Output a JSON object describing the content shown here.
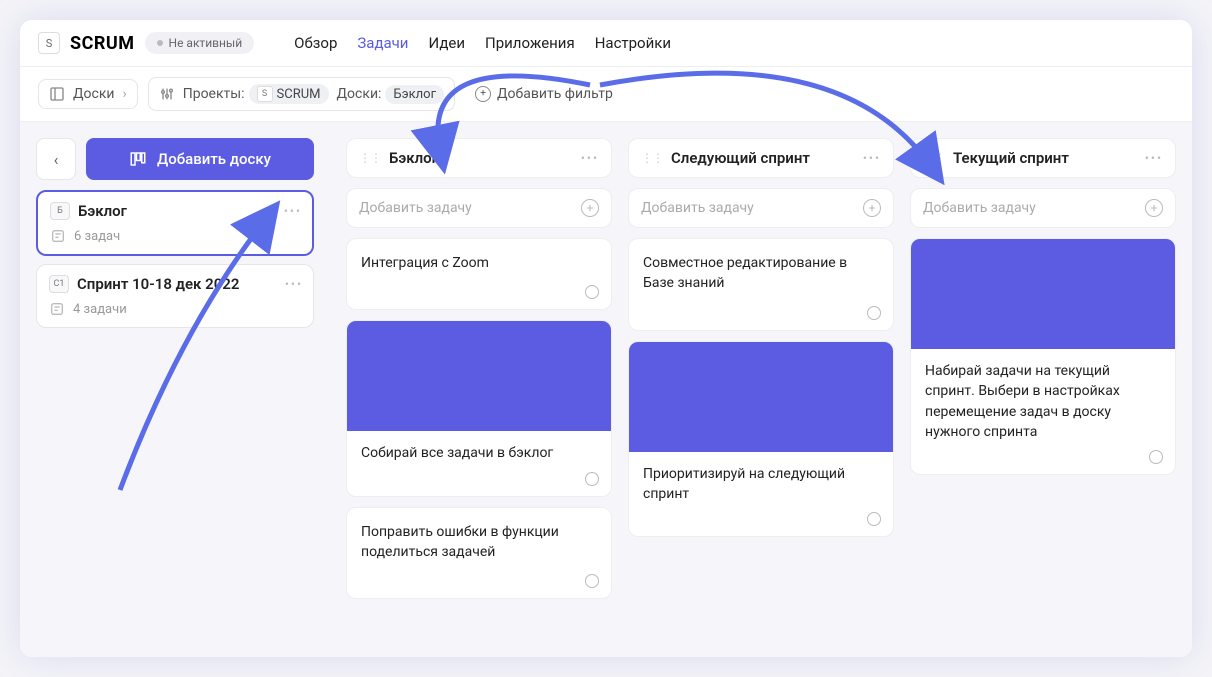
{
  "header": {
    "project_badge": "S",
    "project_name": "SCRUM",
    "status_label": "Не активный",
    "nav": {
      "overview": "Обзор",
      "tasks": "Задачи",
      "ideas": "Идеи",
      "apps": "Приложения",
      "settings": "Настройки"
    }
  },
  "toolbar": {
    "breadcrumb_label": "Доски",
    "filter_projects_label": "Проекты:",
    "filter_projects_badge": "S",
    "filter_projects_value": "SCRUM",
    "filter_boards_label": "Доски:",
    "filter_boards_value": "Бэклог",
    "add_filter_label": "Добавить фильтр"
  },
  "sidebar": {
    "add_board_label": "Добавить доску",
    "boards": [
      {
        "chip": "Б",
        "title": "Бэклог",
        "count": "6 задач",
        "selected": true
      },
      {
        "chip": "С1",
        "title": "Спринт 10-18 дек 2022",
        "count": "4 задачи",
        "selected": false
      }
    ]
  },
  "columns": [
    {
      "title": "Бэклог",
      "add_task_placeholder": "Добавить задачу",
      "cards": [
        {
          "text": "Интеграция с Zoom",
          "has_image": false
        },
        {
          "text": "Собирай все задачи в бэклог",
          "has_image": true
        },
        {
          "text": "Поправить ошибки в функции поделиться задачей",
          "has_image": false
        }
      ]
    },
    {
      "title": "Следующий спринт",
      "add_task_placeholder": "Добавить задачу",
      "cards": [
        {
          "text": "Совместное редактирование в Базе знаний",
          "has_image": false
        },
        {
          "text": "Приоритизируй на следующий спринт",
          "has_image": true
        }
      ]
    },
    {
      "title": "Текущий спринт",
      "add_task_placeholder": "Добавить задачу",
      "cards": [
        {
          "text": "Набирай задачи на текущий спринт. Выбери в настройках перемещение задач в доску нужного спринта",
          "has_image": true
        }
      ]
    }
  ]
}
